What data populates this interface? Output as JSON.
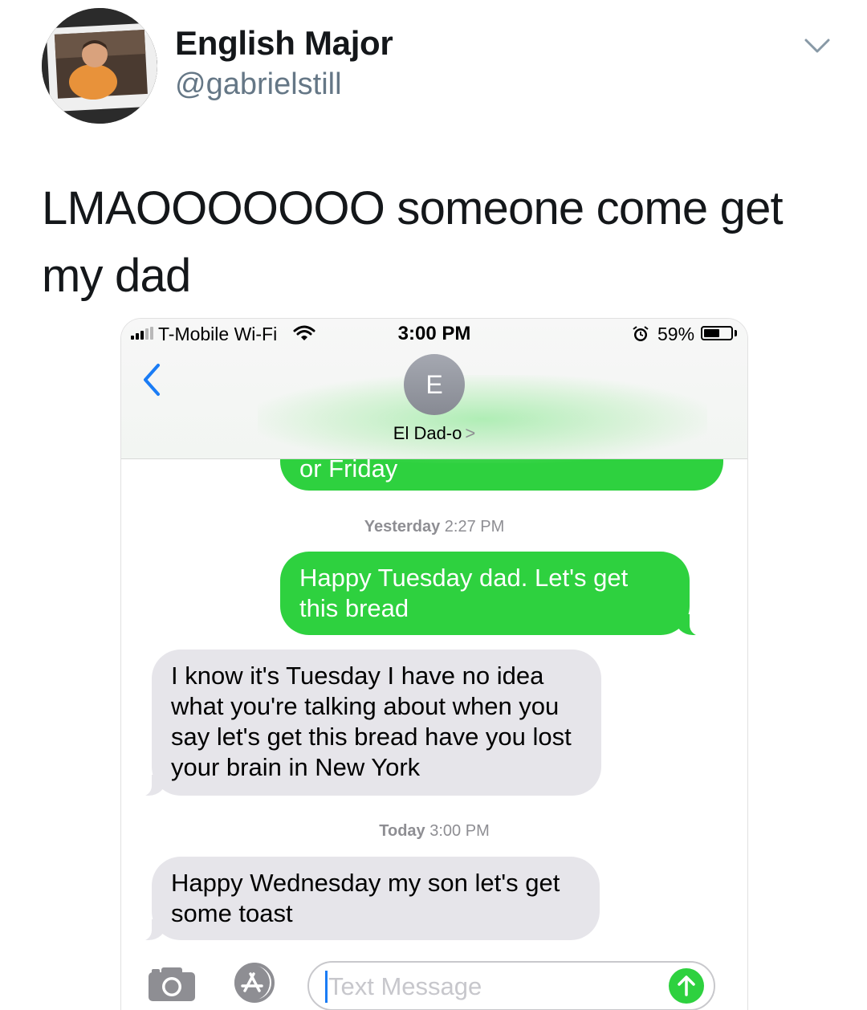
{
  "tweet": {
    "display_name": "English Major",
    "handle": "@gabrielstill",
    "text": "LMAOOOOOOO someone come get my dad"
  },
  "phone": {
    "status": {
      "carrier": "T-Mobile Wi-Fi",
      "time": "3:00 PM",
      "battery": "59%",
      "battery_level": 0.59
    },
    "contact": {
      "initial": "E",
      "name": "El Dad-o",
      "chevron": ">"
    },
    "messages": {
      "partial_sent": "or Friday",
      "stamp1_day": "Yesterday",
      "stamp1_time": "2:27 PM",
      "sent1": "Happy Tuesday dad. Let's get this bread",
      "recv1": "I know it's Tuesday I have no idea what you're talking about when you say let's get this bread have you lost your brain in New York",
      "stamp2_day": "Today",
      "stamp2_time": "3:00 PM",
      "recv2": "Happy Wednesday my son let's get some toast"
    },
    "composer": {
      "placeholder": "Text Message"
    }
  },
  "colors": {
    "imessage_green": "#2ed13f",
    "received_gray": "#e6e5ea",
    "ios_blue": "#1a7cf5",
    "twitter_gray": "#657786"
  },
  "icons": [
    "caret-down-icon",
    "signal-icon",
    "wifi-icon",
    "alarm-icon",
    "battery-icon",
    "back-chevron-icon",
    "camera-icon",
    "app-store-icon",
    "send-arrow-icon"
  ]
}
